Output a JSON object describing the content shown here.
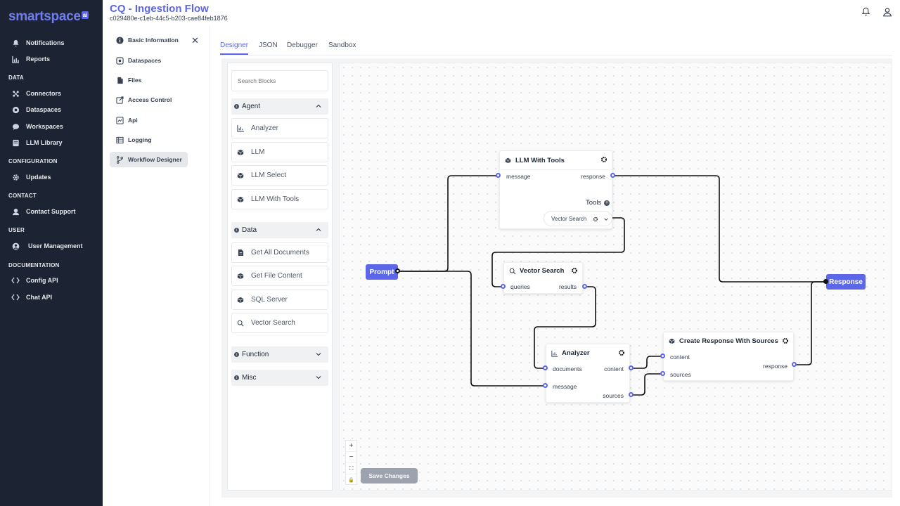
{
  "brand": {
    "name": "smartspace",
    "badge": "ai"
  },
  "sidebar": {
    "top_items": [
      {
        "label": "Notifications",
        "icon": "bell-icon"
      },
      {
        "label": "Reports",
        "icon": "chart-icon"
      }
    ],
    "sections": [
      {
        "title": "DATA",
        "items": [
          {
            "label": "Connectors",
            "icon": "connectors-icon"
          },
          {
            "label": "Dataspaces",
            "icon": "dataspaces-icon"
          },
          {
            "label": "Workspaces",
            "icon": "chat-icon"
          },
          {
            "label": "LLM Library",
            "icon": "library-icon"
          }
        ]
      },
      {
        "title": "CONFIGURATION",
        "items": [
          {
            "label": "Updates",
            "icon": "gear-icon"
          }
        ]
      },
      {
        "title": "CONTACT",
        "items": [
          {
            "label": "Contact Support",
            "icon": "support-icon"
          }
        ]
      },
      {
        "title": "USER",
        "items": [
          {
            "label": "User Management",
            "icon": "user-icon"
          }
        ]
      },
      {
        "title": "DOCUMENTATION",
        "items": [
          {
            "label": "Config API",
            "icon": "code-icon"
          },
          {
            "label": "Chat API",
            "icon": "code-icon"
          }
        ]
      }
    ]
  },
  "header": {
    "title": "CQ - Ingestion Flow",
    "subtitle": "c029480e-c1eb-44c5-b203-cae84feb1876"
  },
  "settings_nav": {
    "items": [
      {
        "label": "Basic Information",
        "icon": "info-icon"
      },
      {
        "label": "Dataspaces",
        "icon": "dataspaces-icon"
      },
      {
        "label": "Files",
        "icon": "file-icon"
      },
      {
        "label": "Access Control",
        "icon": "access-icon"
      },
      {
        "label": "Api",
        "icon": "api-icon"
      },
      {
        "label": "Logging",
        "icon": "table-icon"
      },
      {
        "label": "Workflow Designer",
        "icon": "branch-icon"
      }
    ],
    "active": "Workflow Designer"
  },
  "tabs": [
    {
      "label": "Designer",
      "active": true
    },
    {
      "label": "JSON",
      "active": false
    },
    {
      "label": "Debugger",
      "active": false
    },
    {
      "label": "Sandbox",
      "active": false
    }
  ],
  "palette": {
    "search_placeholder": "Search Blocks",
    "groups": [
      {
        "name": "Agent",
        "expanded": true,
        "items": [
          {
            "label": "Analyzer",
            "icon": "chart-icon"
          },
          {
            "label": "LLM",
            "icon": "cube-icon"
          },
          {
            "label": "LLM Select",
            "icon": "cube-icon"
          },
          {
            "label": "LLM With Tools",
            "icon": "cube-icon"
          }
        ]
      },
      {
        "name": "Data",
        "expanded": true,
        "items": [
          {
            "label": "Get All Documents",
            "icon": "document-icon"
          },
          {
            "label": "Get File Content",
            "icon": "cube-icon"
          },
          {
            "label": "SQL Server",
            "icon": "cube-icon"
          },
          {
            "label": "Vector Search",
            "icon": "search-icon"
          }
        ]
      },
      {
        "name": "Function",
        "expanded": false,
        "items": []
      },
      {
        "name": "Misc",
        "expanded": false,
        "items": []
      }
    ]
  },
  "flow": {
    "prompt": "Prompt",
    "response": "Response",
    "llm_with_tools": {
      "title": "LLM With Tools",
      "input": "message",
      "output": "response",
      "tools_label": "Tools",
      "tool_chip": "Vector Search"
    },
    "vector_search": {
      "title": "Vector Search",
      "input": "queries",
      "output": "results"
    },
    "analyzer": {
      "title": "Analyzer",
      "inputs": [
        "documents",
        "message"
      ],
      "outputs": [
        "content",
        "sources"
      ]
    },
    "create_response": {
      "title": "Create Response With Sources",
      "inputs": [
        "content",
        "sources"
      ],
      "output": "response"
    }
  },
  "canvas_controls": [
    "+",
    "−",
    "⛶",
    "🔒"
  ],
  "save_button": "Save Changes",
  "colors": {
    "accent": "#5b67e8",
    "sidebar_bg": "#1c2433",
    "edge": "#111111"
  }
}
